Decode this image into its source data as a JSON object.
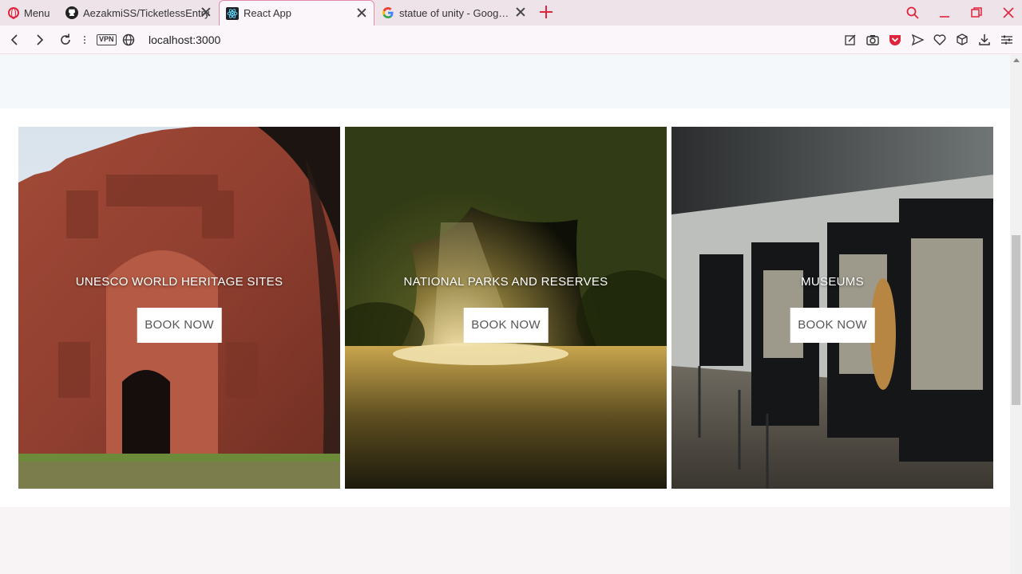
{
  "browser": {
    "menu_label": "Menu",
    "tabs": [
      {
        "title": "AezakmiSS/TicketlessEntry",
        "icon": "github-icon"
      },
      {
        "title": "React App",
        "icon": "react-icon"
      },
      {
        "title": "statue of unity - Google Se",
        "icon": "google-icon"
      }
    ],
    "url": "localhost:3000",
    "vpn_label": "VPN",
    "accent": "#e0243c"
  },
  "cards": [
    {
      "title": "UNESCO WORLD HERITAGE SITES",
      "button": "BOOK NOW"
    },
    {
      "title": "NATIONAL PARKS AND RESERVES",
      "button": "BOOK NOW"
    },
    {
      "title": "MUSEUMS",
      "button": "BOOK NOW"
    }
  ]
}
